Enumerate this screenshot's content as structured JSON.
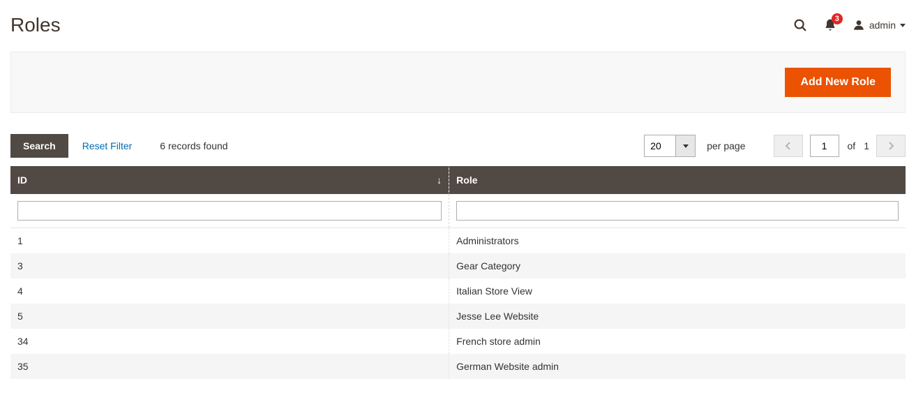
{
  "header": {
    "title": "Roles",
    "notifications_count": "3",
    "username": "admin"
  },
  "actions": {
    "add_new_role": "Add New Role"
  },
  "grid_controls": {
    "search_label": "Search",
    "reset_label": "Reset Filter",
    "records_found": "6 records found",
    "per_page_value": "20",
    "per_page_label": "per page",
    "page_current": "1",
    "of_label": "of",
    "page_total": "1"
  },
  "columns": {
    "id": "ID",
    "role": "Role"
  },
  "filters": {
    "id": "",
    "role": ""
  },
  "rows": [
    {
      "id": "1",
      "role": "Administrators"
    },
    {
      "id": "3",
      "role": "Gear Category"
    },
    {
      "id": "4",
      "role": "Italian Store View"
    },
    {
      "id": "5",
      "role": "Jesse Lee Website"
    },
    {
      "id": "34",
      "role": "French store admin"
    },
    {
      "id": "35",
      "role": "German Website admin"
    }
  ]
}
